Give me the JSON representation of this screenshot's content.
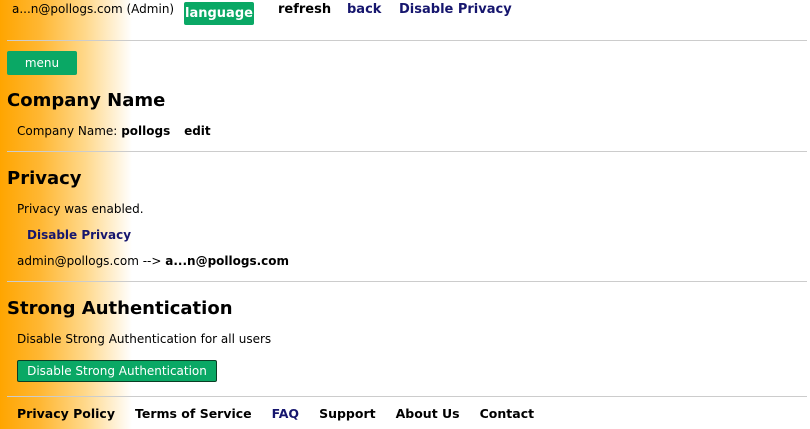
{
  "topbar": {
    "user": "a...n@pollogs.com (Admin)",
    "language": "language",
    "refresh": "refresh",
    "back": "back",
    "disable_privacy": "Disable Privacy"
  },
  "menu_label": "menu",
  "company": {
    "heading": "Company Name",
    "label": "Company Name:",
    "value": "pollogs",
    "edit": "edit"
  },
  "privacy": {
    "heading": "Privacy",
    "status": "Privacy was enabled.",
    "disable_link": "Disable Privacy",
    "mapping_from": "admin@pollogs.com -->",
    "mapping_to": "a...n@pollogs.com"
  },
  "auth": {
    "heading": "Strong Authentication",
    "description": "Disable Strong Authentication for all users",
    "button": "Disable Strong Authentication"
  },
  "footer": {
    "privacy_policy": "Privacy Policy",
    "terms": "Terms of Service",
    "faq": "FAQ",
    "support": "Support",
    "about": "About Us",
    "contact": "Contact"
  },
  "colors": {
    "accent_green": "#0aa865",
    "link_navy": "#16166e",
    "sidebar_orange": "#ffa500"
  }
}
